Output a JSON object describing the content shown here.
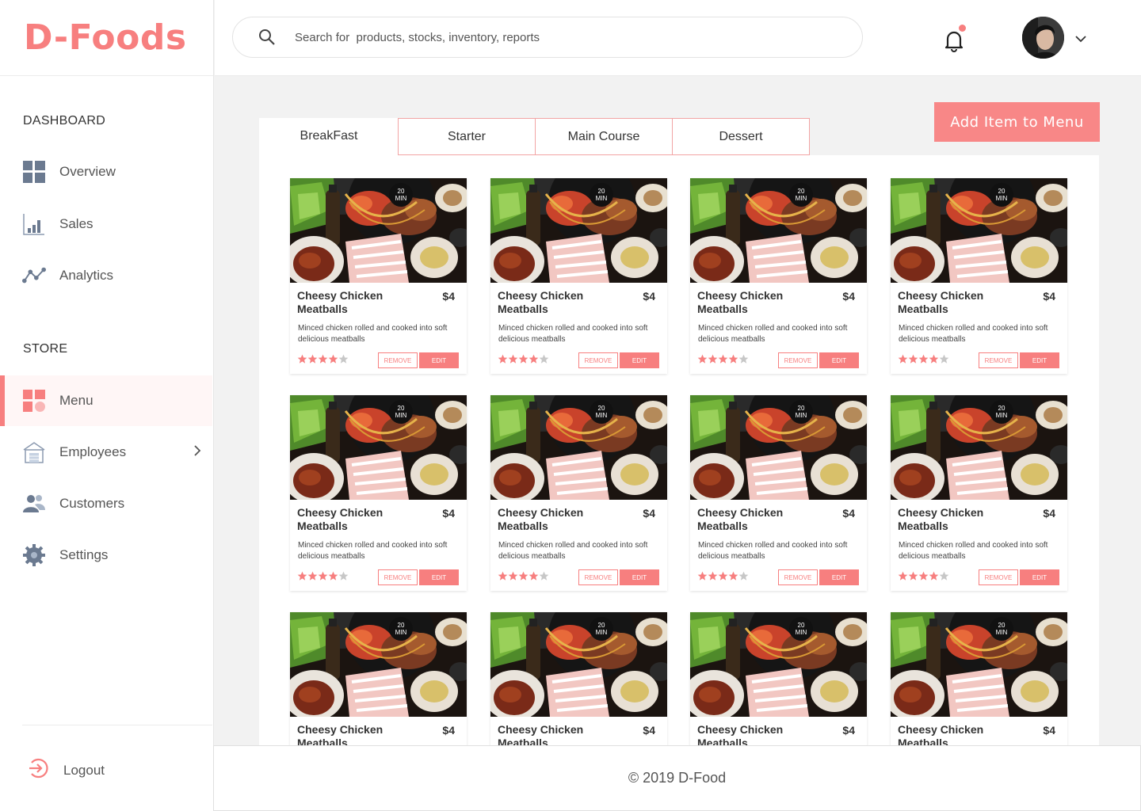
{
  "brand": {
    "name": "D-Foods",
    "accent": "#f77f7f"
  },
  "header": {
    "search_placeholder": "Search for  products, stocks, inventory, reports"
  },
  "sidebar": {
    "section_dashboard": "DASHBOARD",
    "section_store": "STORE",
    "items": [
      {
        "label": "Overview",
        "icon": "grid-icon"
      },
      {
        "label": "Sales",
        "icon": "bar-chart-icon"
      },
      {
        "label": "Analytics",
        "icon": "line-graph-icon"
      },
      {
        "label": "Menu",
        "icon": "menu-tiles-icon",
        "active": true
      },
      {
        "label": "Employees",
        "icon": "building-icon"
      },
      {
        "label": "Customers",
        "icon": "users-icon"
      },
      {
        "label": "Settings",
        "icon": "gear-icon"
      }
    ],
    "logout": "Logout"
  },
  "tabs": [
    "BreakFast",
    "Starter",
    "Main Course",
    "Dessert"
  ],
  "add_button": "Add Item to Menu",
  "card": {
    "badge_top": "20",
    "badge_bottom": "MIN",
    "name": "Cheesy Chicken Meatballs",
    "price": "$4",
    "description": "Minced chicken rolled and cooked into soft delicious meatballs",
    "rating": 4,
    "rating_max": 5,
    "remove_label": "REMOVE",
    "edit_label": "EDIT"
  },
  "footer": "© 2019 D-Food"
}
